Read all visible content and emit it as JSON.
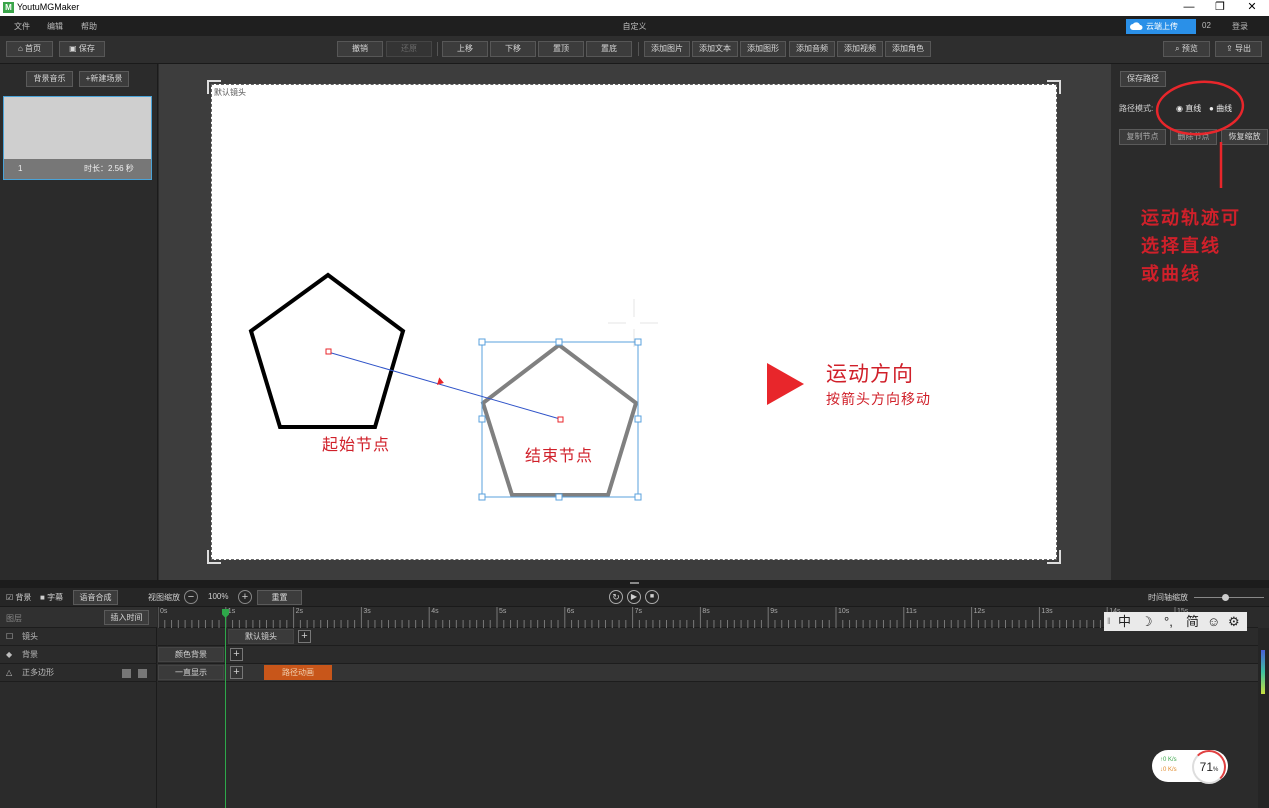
{
  "app": {
    "title": "YoutuMGMaker",
    "logo_glyph": "M"
  },
  "window_controls": {
    "minimize": "—",
    "restore": "❐",
    "close": "✕"
  },
  "menu": {
    "items": [
      "文件",
      "编辑",
      "帮助"
    ],
    "center_title": "自定义",
    "cloud_upload": "云端上传",
    "user_id": "02",
    "login": "登录"
  },
  "toolbar": {
    "home": "首页",
    "save": "保存",
    "undo": "撤销",
    "redo": "还原",
    "move_up": "上移",
    "move_down": "下移",
    "to_top": "置顶",
    "to_bottom": "置底",
    "add_image": "添加图片",
    "add_text": "添加文本",
    "add_shape": "添加图形",
    "add_audio": "添加音频",
    "add_video": "添加视频",
    "add_character": "添加角色",
    "preview": "预览",
    "export": "导出"
  },
  "left_panel": {
    "bg_music": "背景音乐",
    "new_scene": "+新建场景",
    "scene_index": "1",
    "scene_duration": "时长：2.56 秒"
  },
  "stage": {
    "camera_label": "默认镜头",
    "start_node": "起始节点",
    "end_node": "结束节点",
    "direction_title": "运动方向",
    "direction_sub": "按箭头方向移动"
  },
  "right_panel": {
    "save_path": "保存路径",
    "path_mode_label": "路径模式:",
    "mode_straight": "直线",
    "mode_curve": "曲线",
    "copy_node": "复制节点",
    "delete_node": "删除节点",
    "restore_zoom": "恢复缩放",
    "annotation": [
      "运动轨迹可",
      "选择直线",
      "或曲线"
    ]
  },
  "timeline": {
    "bg_toggle": "背景",
    "subtitle_toggle": "字幕",
    "voice_synth": "语音合成",
    "view_zoom": "视图缩放",
    "zoom_value": "100%",
    "reset": "重置",
    "time_zoom": "时间轴缩放",
    "layers_header": "图层",
    "insert_time": "插入时间",
    "ruler": [
      "0s",
      "1s",
      "2s",
      "3s",
      "4s",
      "5s",
      "6s",
      "7s",
      "8s",
      "9s",
      "10s",
      "11s",
      "12s",
      "13s",
      "14s",
      "15s"
    ],
    "tracks": [
      {
        "name": "镜头",
        "clip": "默认镜头"
      },
      {
        "name": "背景",
        "clip": "颜色背景"
      },
      {
        "name": "正多边形",
        "clip": "一直显示",
        "path_clip": "路径动画"
      }
    ]
  },
  "ime": {
    "items": [
      "中",
      "☽",
      "°,",
      "简",
      "☺",
      "⚙"
    ]
  },
  "cpu": {
    "up": "↑0  K/s",
    "down": "↓0  K/s",
    "percent": "71",
    "unit": "%"
  },
  "colors": {
    "accent_red": "#e8262b",
    "selection_blue": "#3a87d8",
    "path_clip": "#c8561a",
    "playhead": "#2ea84a"
  }
}
